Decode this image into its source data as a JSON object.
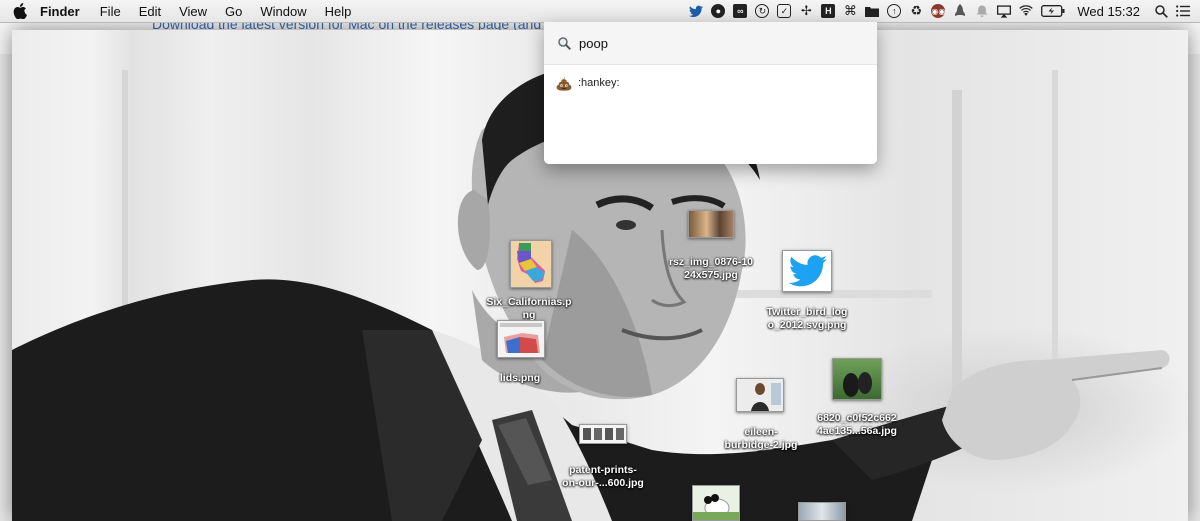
{
  "menubar": {
    "app_name": "Finder",
    "items": [
      "File",
      "Edit",
      "View",
      "Go",
      "Window",
      "Help"
    ],
    "clock": "Wed 15:32",
    "status_icons": [
      "twitter-icon",
      "disc-icon",
      "cc-icon",
      "sync-icon",
      "checkbox-icon",
      "pinwheel-icon",
      "h-box-icon",
      "command-icon",
      "folder-icon",
      "upload-icon",
      "recycle-icon",
      "owl-icon",
      "rocket-icon",
      "bell-icon",
      "airplay-icon",
      "wifi-icon",
      "battery-icon"
    ]
  },
  "background_window": {
    "text": "Download the latest version for Mac on the releases page (and dra"
  },
  "spotlight": {
    "query": "poop",
    "result_label": ":hankey:",
    "search_icon": "magnifier-icon",
    "result_icon": "pile-of-poo-icon"
  },
  "desktop_files": [
    {
      "name": "rsz_img_0876-1024x575.jpg",
      "label_lines": [
        "rsz_img_0876-10",
        "24x575.jpg"
      ]
    },
    {
      "name": "Six_Californias.png",
      "label_lines": [
        "Six_Californias.p",
        "ng"
      ]
    },
    {
      "name": "Twitter_bird_logo_2012.svg.png",
      "label_lines": [
        "Twitter_bird_log",
        "o_2012.svg.png"
      ]
    },
    {
      "name": "lids.png",
      "label_lines": [
        "lids.png"
      ]
    },
    {
      "name": "6820_c0f52c6624ae135...56a.jpg",
      "label_lines": [
        "6820_c0f52c662",
        "4ae135...56a.jpg"
      ]
    },
    {
      "name": "eileen-burbidge-2.jpg",
      "label_lines": [
        "eileen-",
        "burbidge-2.jpg"
      ]
    },
    {
      "name": "patent-prints-on-our-...600.jpg",
      "label_lines": [
        "patent-prints-",
        "on-our-...600.jpg"
      ]
    },
    {
      "name": "panda",
      "label_lines": []
    },
    {
      "name": "unknown",
      "label_lines": []
    }
  ],
  "colors": {
    "twitter_blue": "#1da1f2",
    "link_blue": "#3b6cb3"
  }
}
